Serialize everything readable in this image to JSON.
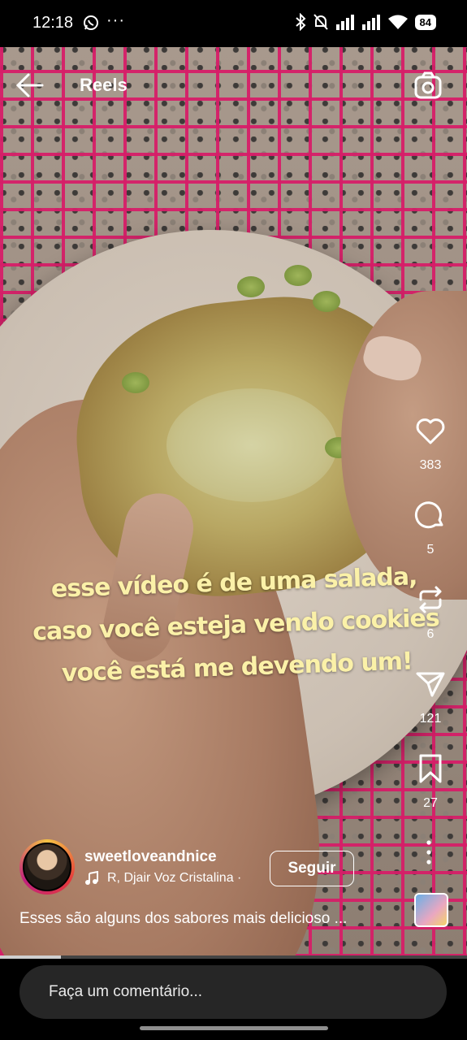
{
  "status_bar": {
    "time": "12:18",
    "more": "···",
    "battery": "84"
  },
  "top_bar": {
    "title": "Reels"
  },
  "overlay_text": {
    "line1": "esse vídeo é de uma salada,",
    "line2": "caso você esteja vendo cookies",
    "line3": "você está me devendo um!"
  },
  "actions": {
    "likes": "383",
    "comments": "5",
    "reposts": "6",
    "shares": "121",
    "saves": "27"
  },
  "post": {
    "username": "sweetloveandnice",
    "audio": "R, Djair Voz Cristalina ·",
    "follow_label": "Seguir",
    "caption": "Esses são alguns dos sabores mais delicioso ..."
  },
  "comment": {
    "placeholder": "Faça um comentário..."
  },
  "video_progress": 0.13,
  "icons": {
    "back": "arrow-left-icon",
    "camera": "camera-icon",
    "like": "heart-icon",
    "comment": "comment-bubble-icon",
    "repost": "repost-icon",
    "share": "paper-plane-icon",
    "save": "bookmark-icon",
    "more": "more-vertical-icon",
    "music": "music-note-icon"
  },
  "colors": {
    "overlay_text": "#fbf1a8",
    "rack": "#d61e68",
    "comment_bar": "#262626"
  }
}
